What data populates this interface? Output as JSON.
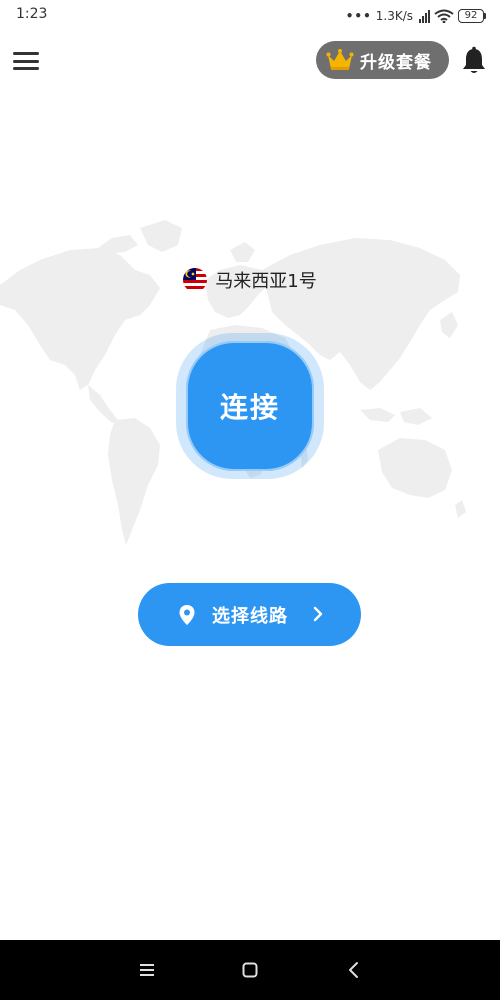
{
  "status_bar": {
    "time": "1:23",
    "network_speed": "1.3K/s",
    "battery_level": "92",
    "icons": [
      "dots-icon",
      "signal-icon",
      "wifi-icon",
      "battery-icon"
    ]
  },
  "header": {
    "menu_icon": "hamburger-menu-icon",
    "upgrade_label": "升级套餐",
    "crown_icon": "crown-icon",
    "bell_icon": "bell-icon"
  },
  "server": {
    "name": "马来西亚1号",
    "flag_icon": "malaysia-flag-icon"
  },
  "connect": {
    "label": "连接"
  },
  "route": {
    "label": "选择线路",
    "location_icon": "location-pin-icon",
    "chevron_icon": "chevron-right-icon"
  },
  "nav_bar": {
    "icons": [
      "menu-lines-icon",
      "home-square-icon",
      "back-chevron-icon"
    ]
  },
  "colors": {
    "accent": "#2d96f3",
    "upgrade_bg": "#6f6f6f",
    "map_land": "#eeeeee",
    "crown": "#f5b400",
    "nav_bg": "#000000"
  }
}
